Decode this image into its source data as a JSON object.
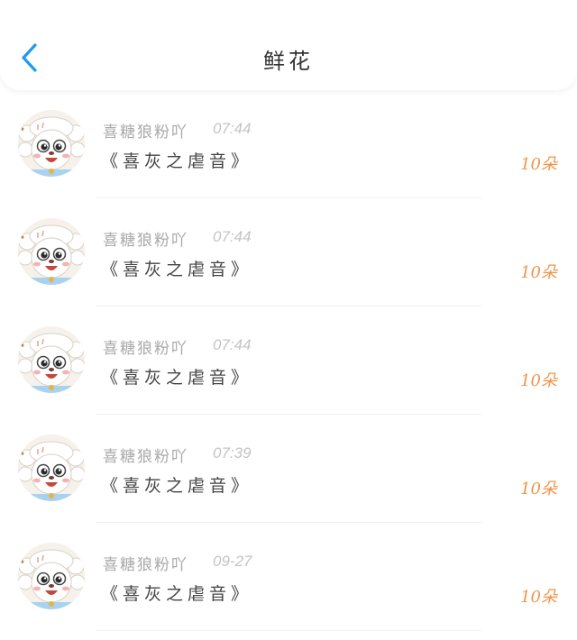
{
  "header": {
    "title": "鲜花",
    "back_icon": "chevron-left-icon",
    "accent_color": "#1e9bf0"
  },
  "list": {
    "items": [
      {
        "name": "喜糖狼粉吖",
        "time": "07:44",
        "message": "《喜灰之虐音》",
        "amount": "10朵"
      },
      {
        "name": "喜糖狼粉吖",
        "time": "07:44",
        "message": "《喜灰之虐音》",
        "amount": "10朵"
      },
      {
        "name": "喜糖狼粉吖",
        "time": "07:44",
        "message": "《喜灰之虐音》",
        "amount": "10朵"
      },
      {
        "name": "喜糖狼粉吖",
        "time": "07:39",
        "message": "《喜灰之虐音》",
        "amount": "10朵"
      },
      {
        "name": "喜糖狼粉吖",
        "time": "09-27",
        "message": "《喜灰之虐音》",
        "amount": "10朵"
      }
    ],
    "amount_color": "#f0954a"
  }
}
